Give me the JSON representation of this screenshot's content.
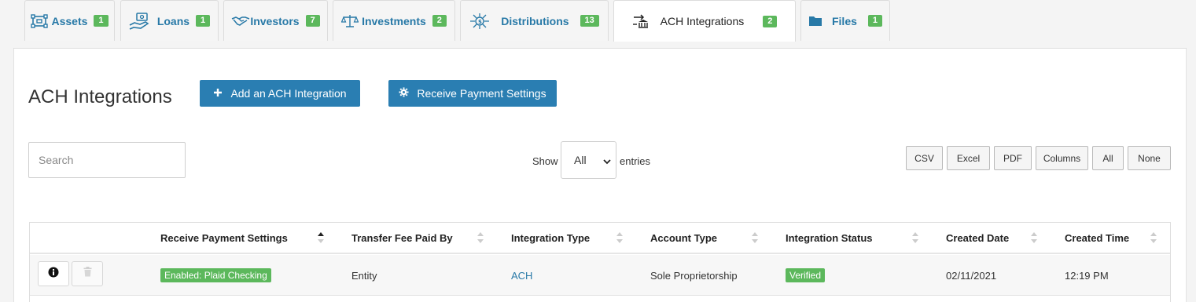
{
  "tabs": [
    {
      "label": "Assets",
      "count": "1",
      "icon": "assets-icon"
    },
    {
      "label": "Loans",
      "count": "1",
      "icon": "loans-icon"
    },
    {
      "label": "Investors",
      "count": "7",
      "icon": "handshake-icon"
    },
    {
      "label": "Investments",
      "count": "2",
      "icon": "scales-icon"
    },
    {
      "label": "Distributions",
      "count": "13",
      "icon": "distributions-icon"
    },
    {
      "label": "ACH Integrations",
      "count": "2",
      "icon": "bank-transfer-icon"
    },
    {
      "label": "Files",
      "count": "1",
      "icon": "folder-icon"
    }
  ],
  "active_tab": "ACH Integrations",
  "page": {
    "title": "ACH Integrations",
    "add_button": "Add an ACH Integration",
    "settings_button": "Receive Payment Settings"
  },
  "controls": {
    "search_placeholder": "Search",
    "show_label": "Show",
    "entries_label": "entries",
    "page_size": "All",
    "export_buttons": [
      "CSV",
      "Excel",
      "PDF",
      "Columns",
      "All",
      "None"
    ]
  },
  "table": {
    "columns": [
      "Receive Payment Settings",
      "Transfer Fee Paid By",
      "Integration Type",
      "Account Type",
      "Integration Status",
      "Created Date",
      "Created Time"
    ],
    "rows": [
      {
        "receive_payment_settings": "Enabled: Plaid Checking",
        "transfer_fee_paid_by": "Entity",
        "integration_type": "ACH",
        "account_type": "Sole Proprietorship",
        "integration_status": "Verified",
        "created_date": "02/11/2021",
        "created_time": "12:19 PM"
      }
    ]
  },
  "colors": {
    "primary": "#2a7eb2",
    "badge_green": "#5cb85c",
    "tab_text": "#2879a7"
  }
}
